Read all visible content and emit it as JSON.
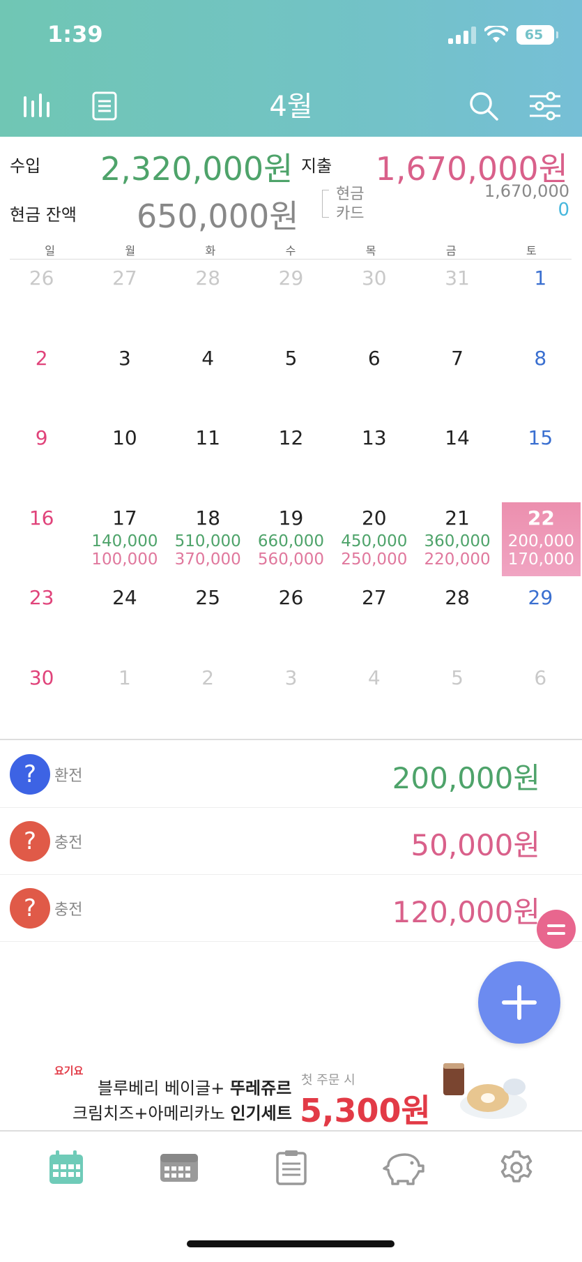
{
  "status_bar": {
    "time": "1:39",
    "battery": "65"
  },
  "header": {
    "title": "4월",
    "icons": [
      "chart-icon",
      "list-icon",
      "search-icon",
      "filter-icon"
    ]
  },
  "summary": {
    "income_label": "수입",
    "income_value": "2,320,000원",
    "expense_label": "지출",
    "expense_value": "1,670,000원",
    "balance_label": "현금 잔액",
    "balance_value": "650,000원",
    "cash_label": "현금",
    "cash_value": "1,670,000",
    "card_label": "카드",
    "card_value": "0"
  },
  "calendar": {
    "weekdays": [
      "일",
      "월",
      "화",
      "수",
      "목",
      "금",
      "토"
    ],
    "days": [
      {
        "num": "26",
        "other": true
      },
      {
        "num": "27",
        "other": true
      },
      {
        "num": "28",
        "other": true
      },
      {
        "num": "29",
        "other": true
      },
      {
        "num": "30",
        "other": true
      },
      {
        "num": "31",
        "other": true
      },
      {
        "num": "1"
      },
      {
        "num": "2"
      },
      {
        "num": "3"
      },
      {
        "num": "4"
      },
      {
        "num": "5"
      },
      {
        "num": "6"
      },
      {
        "num": "7"
      },
      {
        "num": "8"
      },
      {
        "num": "9"
      },
      {
        "num": "10"
      },
      {
        "num": "11"
      },
      {
        "num": "12"
      },
      {
        "num": "13"
      },
      {
        "num": "14"
      },
      {
        "num": "15"
      },
      {
        "num": "16"
      },
      {
        "num": "17",
        "income": "140,000",
        "expense": "100,000"
      },
      {
        "num": "18",
        "income": "510,000",
        "expense": "370,000"
      },
      {
        "num": "19",
        "income": "660,000",
        "expense": "560,000"
      },
      {
        "num": "20",
        "income": "450,000",
        "expense": "250,000"
      },
      {
        "num": "21",
        "income": "360,000",
        "expense": "220,000"
      },
      {
        "num": "22",
        "income": "200,000",
        "expense": "170,000",
        "today": true
      },
      {
        "num": "23"
      },
      {
        "num": "24"
      },
      {
        "num": "25"
      },
      {
        "num": "26"
      },
      {
        "num": "27"
      },
      {
        "num": "28"
      },
      {
        "num": "29"
      },
      {
        "num": "30"
      },
      {
        "num": "1",
        "other": true
      },
      {
        "num": "2",
        "other": true
      },
      {
        "num": "3",
        "other": true
      },
      {
        "num": "4",
        "other": true
      },
      {
        "num": "5",
        "other": true
      },
      {
        "num": "6",
        "other": true
      }
    ]
  },
  "transactions": [
    {
      "icon": "?",
      "label": "환전",
      "amount": "200,000원",
      "type": "income",
      "color": "#3d63e4"
    },
    {
      "icon": "?",
      "label": "충전",
      "amount": "50,000원",
      "type": "expense",
      "color": "#e05a48"
    },
    {
      "icon": "?",
      "label": "충전",
      "amount": "120,000원",
      "type": "expense",
      "color": "#e05a48"
    }
  ],
  "ad": {
    "brand": "요기요",
    "line1_a": "블루베리 베이글+",
    "line1_b": "뚜레쥬르",
    "line2_a": "크림치즈+아메리카노",
    "line2_b": "인기세트",
    "note": "첫 주문 시",
    "price": "5,300원"
  },
  "tabbar": [
    "calendar-icon",
    "weekly-calendar-icon",
    "report-icon",
    "piggy-bank-icon",
    "settings-icon"
  ],
  "colors": {
    "income": "#4ea36a",
    "expense": "#d9608a",
    "accent": "#72c4c4",
    "today": "#ec8fae",
    "fab": "#6c8bf0"
  }
}
